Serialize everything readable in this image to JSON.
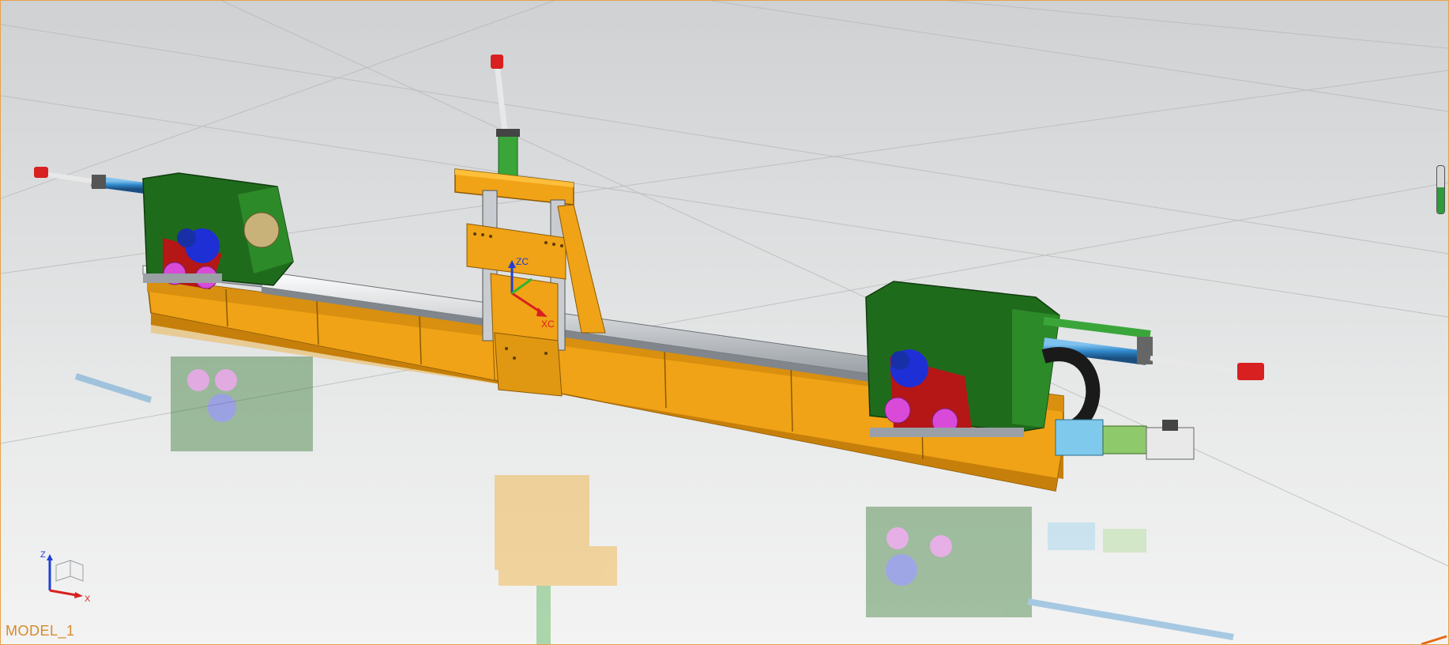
{
  "viewport": {
    "model_name": "MODEL_1",
    "colors": {
      "frame": "#f0a316",
      "housing": "#1f6b1c",
      "plate": "#b51616",
      "wheel": "#d94ad8",
      "hub": "#1f2fd6",
      "rail": "#bfc3c7",
      "cylinder": "#2e86c9",
      "border": "#e8a24a"
    }
  },
  "wcs": {
    "zc_label": "ZC",
    "xc_label": "XC"
  },
  "triad": {
    "z_label": "Z",
    "x_label": "X"
  },
  "zoom": {
    "level": 0.55
  }
}
